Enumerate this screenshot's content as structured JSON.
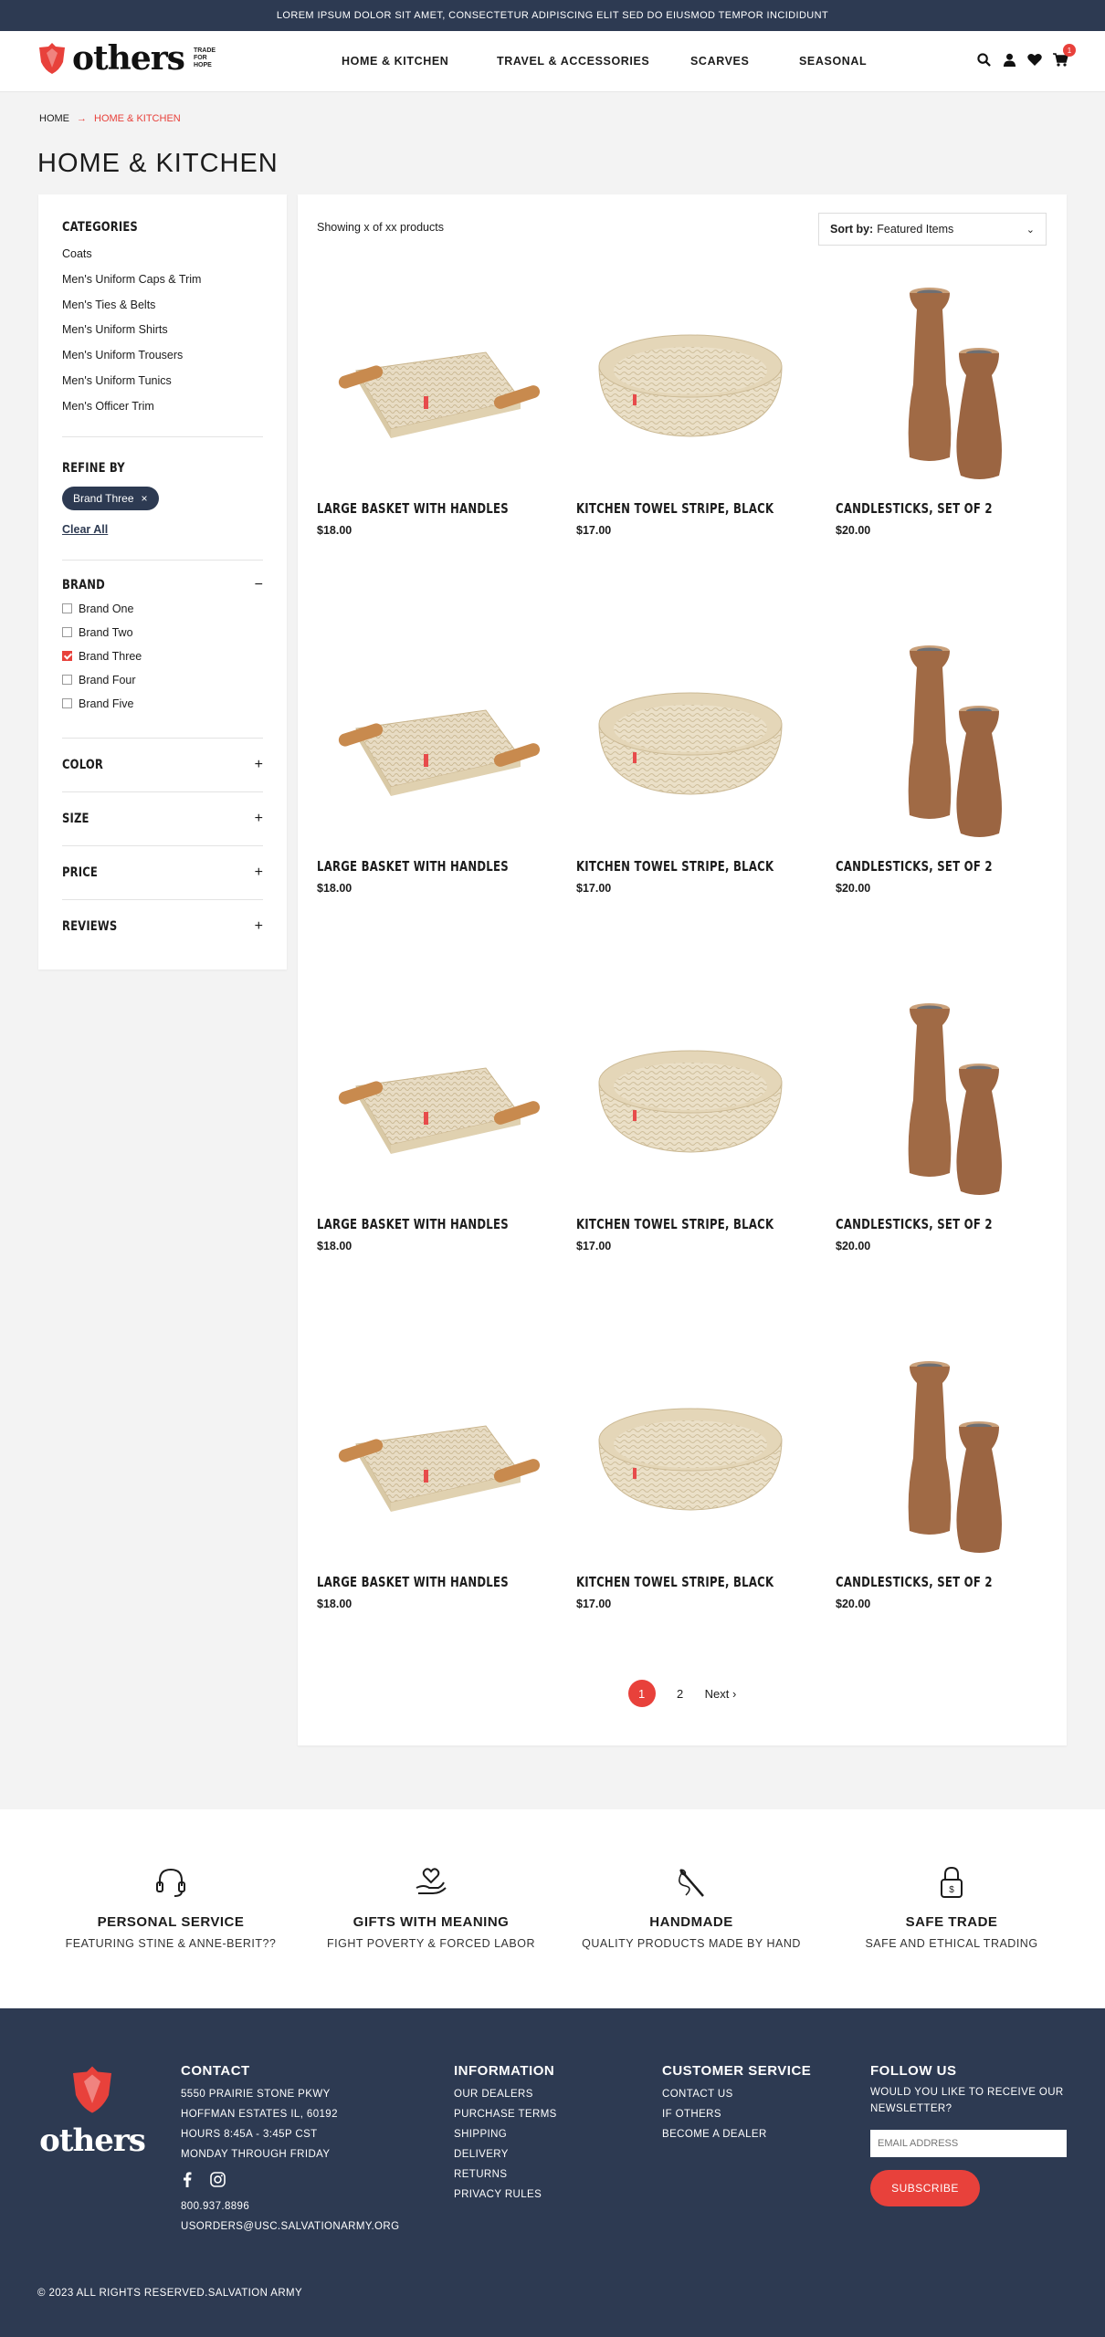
{
  "topbar": {
    "text": "LOREM IPSUM DOLOR SIT AMET, CONSECTETUR ADIPISCING ELIT SED DO EIUSMOD TEMPOR INCIDIDUNT"
  },
  "logo": {
    "word": "others",
    "tagline_1": "TRADE",
    "tagline_2": "FOR",
    "tagline_3": "HOPE",
    "badge_text": "THE SALVATION ARMY"
  },
  "nav": {
    "items": [
      "HOME & KITCHEN",
      "TRAVEL & ACCESSORIES",
      "SCARVES",
      "SEASONAL"
    ]
  },
  "header_icons": {
    "icons": [
      "search-icon",
      "user-icon",
      "heart-icon",
      "cart-icon"
    ],
    "cart_count": "1"
  },
  "breadcrumb": {
    "home": "HOME",
    "separator": "→",
    "current": "HOME & KITCHEN"
  },
  "page": {
    "title": "HOME & KITCHEN"
  },
  "sidebar": {
    "categories_title": "CATEGORIES",
    "categories": [
      "Coats",
      "Men's Uniform Caps & Trim",
      "Men's Ties & Belts",
      "Men's Uniform Shirts",
      "Men's Uniform Trousers",
      "Men's Uniform Tunics",
      "Men's Officer Trim"
    ],
    "refine_title": "REFINE BY",
    "active_filter": "Brand Three",
    "active_filter_remove": "×",
    "clear_all": "Clear All",
    "brand_title": "BRAND",
    "brand_toggle": "−",
    "brands": [
      {
        "label": "Brand One",
        "checked": false
      },
      {
        "label": "Brand Two",
        "checked": false
      },
      {
        "label": "Brand Three",
        "checked": true
      },
      {
        "label": "Brand Four",
        "checked": false
      },
      {
        "label": "Brand Five",
        "checked": false
      }
    ],
    "facets": [
      {
        "label": "COLOR",
        "toggle": "+"
      },
      {
        "label": "SIZE",
        "toggle": "+"
      },
      {
        "label": "PRICE",
        "toggle": "+"
      },
      {
        "label": "REVIEWS",
        "toggle": "+"
      }
    ]
  },
  "listing": {
    "showing": "Showing x of xx products",
    "sort_label": "Sort by:",
    "sort_value": "Featured Items",
    "products": [
      {
        "name": "LARGE BASKET WITH HANDLES",
        "price": "$18.00",
        "image": "basket-with-handles"
      },
      {
        "name": "KITCHEN TOWEL STRIPE, BLACK",
        "price": "$17.00",
        "image": "round-woven-bowl"
      },
      {
        "name": "CANDLESTICKS, SET OF 2",
        "price": "$20.00",
        "image": "wooden-candlesticks"
      },
      {
        "name": "LARGE BASKET WITH HANDLES",
        "price": "$18.00",
        "image": "basket-with-handles"
      },
      {
        "name": "KITCHEN TOWEL STRIPE, BLACK",
        "price": "$17.00",
        "image": "round-woven-bowl"
      },
      {
        "name": "CANDLESTICKS, SET OF 2",
        "price": "$20.00",
        "image": "wooden-candlesticks"
      },
      {
        "name": "LARGE BASKET WITH HANDLES",
        "price": "$18.00",
        "image": "basket-with-handles"
      },
      {
        "name": "KITCHEN TOWEL STRIPE, BLACK",
        "price": "$17.00",
        "image": "round-woven-bowl"
      },
      {
        "name": "CANDLESTICKS, SET OF 2",
        "price": "$20.00",
        "image": "wooden-candlesticks"
      },
      {
        "name": "LARGE BASKET WITH HANDLES",
        "price": "$18.00",
        "image": "basket-with-handles"
      },
      {
        "name": "KITCHEN TOWEL STRIPE, BLACK",
        "price": "$17.00",
        "image": "round-woven-bowl"
      },
      {
        "name": "CANDLESTICKS, SET OF 2",
        "price": "$20.00",
        "image": "wooden-candlesticks"
      }
    ],
    "pagination": {
      "pages": [
        "1",
        "2"
      ],
      "current": "1",
      "next": "Next",
      "next_icon": "›"
    }
  },
  "features": [
    {
      "title": "PERSONAL SERVICE",
      "subtitle": "FEATURING STINE & ANNE-BERIT??",
      "icon": "headset-icon"
    },
    {
      "title": "GIFTS WITH MEANING",
      "subtitle": "FIGHT POVERTY & FORCED LABOR",
      "icon": "heart-hand-icon"
    },
    {
      "title": "HANDMADE",
      "subtitle": "QUALITY PRODUCTS MADE BY HAND",
      "icon": "needle-icon"
    },
    {
      "title": "SAFE TRADE",
      "subtitle": "SAFE AND ETHICAL TRADING",
      "icon": "padlock-icon"
    }
  ],
  "footer": {
    "logo_word": "others",
    "contact": {
      "title": "CONTACT",
      "lines": [
        "5550 PRAIRIE STONE PKWY",
        "HOFFMAN ESTATES IL, 60192",
        "HOURS 8:45A - 3:45P CST",
        "MONDAY THROUGH FRIDAY"
      ],
      "phone": "800.937.8896",
      "email": "USORDERS@USC.SALVATIONARMY.ORG"
    },
    "information": {
      "title": "INFORMATION",
      "links": [
        "OUR DEALERS",
        "PURCHASE TERMS",
        "SHIPPING",
        "DELIVERY",
        "RETURNS",
        "PRIVACY RULES"
      ]
    },
    "customer_service": {
      "title": "CUSTOMER SERVICE",
      "links": [
        "CONTACT US",
        "IF OTHERS",
        "BECOME A DEALER"
      ]
    },
    "follow": {
      "title": "FOLLOW US",
      "text": "WOULD YOU LIKE TO RECEIVE OUR NEWSLETTER?",
      "email_placeholder": "EMAIL ADDRESS",
      "button": "SUBSCRIBE"
    },
    "copyright": "© 2023 ALL RIGHTS RESERVED.SALVATION ARMY"
  },
  "colors": {
    "navy": "#2d3a52",
    "accent": "#e8413b",
    "background": "#f3f3f3"
  }
}
